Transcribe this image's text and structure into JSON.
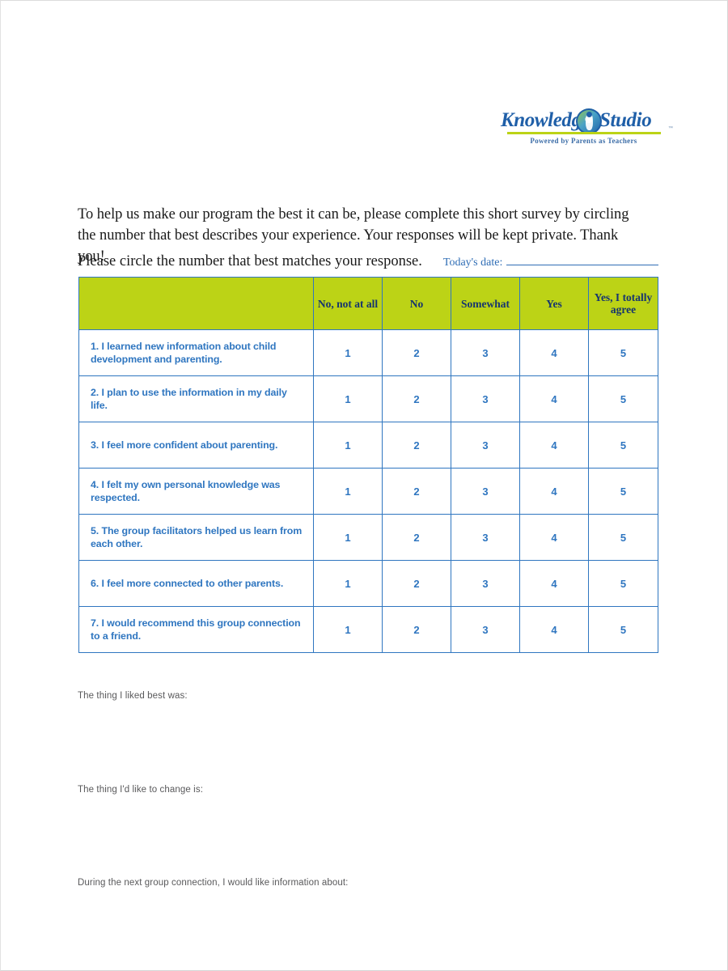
{
  "logo": {
    "word_left": "Knowledge",
    "word_right": "Studio",
    "trademark": "™",
    "tagline": "Powered by Parents as Teachers",
    "emblem_name": "knowledge-studio-emblem",
    "colors": {
      "blue": "#1f5fa8",
      "green": "#bcd316"
    }
  },
  "intro": {
    "paragraph": "To help us make our program the best it can be, please complete this short survey by circling the number that best describes your experience. Your responses will be kept private. Thank you!",
    "subhead": "Please circle the number that best matches your response.",
    "date_label": "Today's date:",
    "date_value": ""
  },
  "table": {
    "header_blank": "",
    "columns": [
      "No, not at all",
      "No",
      "Somewhat",
      "Yes",
      "Yes, I totally agree"
    ],
    "scale": [
      "1",
      "2",
      "3",
      "4",
      "5"
    ],
    "rows": [
      {
        "num": "1.",
        "text": "I learned new information about child development and parenting."
      },
      {
        "num": "2.",
        "text": "I plan to use the information in my daily life."
      },
      {
        "num": "3.",
        "text": "I feel more confident about parenting."
      },
      {
        "num": "4.",
        "text": "I felt my own personal knowledge was respected."
      },
      {
        "num": "5.",
        "text": "The group facilitators helped us learn from each other."
      },
      {
        "num": "6.",
        "text": "I feel more connected to other parents."
      },
      {
        "num": "7.",
        "text": "I would recommend this group connection to a friend."
      }
    ],
    "header_bg": "#bcd316",
    "header_text_color": "#16356f",
    "border_color": "#2f76c0",
    "body_text_color": "#2f76c0"
  },
  "open_ended": [
    "The thing I liked best was:",
    "The thing I'd like to change is:",
    "During the next group connection, I would like information about:"
  ]
}
